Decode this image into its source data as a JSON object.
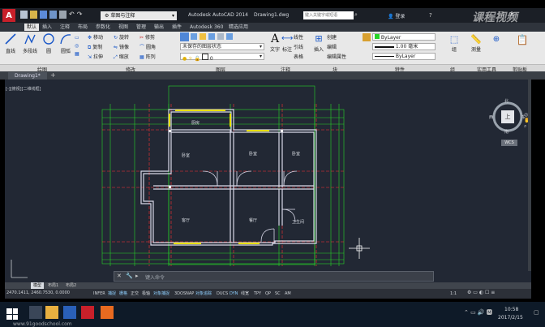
{
  "titlebar": {
    "workspace": "草图与注释",
    "app_title": "Autodesk AutoCAD 2014",
    "doc_title": "Drawing1.dwg",
    "search_placeholder": "键入关键字或短语",
    "login": "登录",
    "watermark": "课程视频"
  },
  "ribbon_tabs": [
    "默认",
    "插入",
    "注释",
    "布局",
    "参数化",
    "视图",
    "管理",
    "输出",
    "插件",
    "Autodesk 360",
    "精选应用"
  ],
  "ribbon": {
    "draw": [
      "直线",
      "多段线",
      "圆",
      "圆弧"
    ],
    "modify": [
      "移动",
      "旋转",
      "修剪",
      "复制",
      "镜像",
      "圆角",
      "拉伸",
      "缩放",
      "阵列"
    ],
    "layer_state": "未保存的图层状态",
    "layer_current": "0",
    "annotation": [
      "文字",
      "标注",
      "线性",
      "引线",
      "表格"
    ],
    "block": [
      "插入",
      "创建",
      "编辑",
      "编辑属性"
    ],
    "properties": [
      "ByLayer",
      "1.00 毫米",
      "ByLayer"
    ],
    "right": [
      "组",
      "测量",
      "基点",
      "剪贴板"
    ],
    "panel_labels": [
      "绘图",
      "修改",
      "图层",
      "注释",
      "块",
      "特性",
      "组",
      "实用工具",
      "剪贴板"
    ]
  },
  "doc_tab": "Drawing1*",
  "viewport_label": "[-][俯视][二维线框]",
  "viewcube": {
    "face": "上",
    "north": "北",
    "south": "南",
    "east": "东",
    "west": "西",
    "wcs": "WCS"
  },
  "rooms": [
    "厨房",
    "卧室",
    "卧室",
    "卧室",
    "客厅",
    "餐厅",
    "卫生间"
  ],
  "command": {
    "placeholder": "键入命令"
  },
  "layout_tabs": [
    "模型",
    "布局1",
    "布局2"
  ],
  "status": {
    "coords": "2470.1411, 2460.7530, 0.0000",
    "buttons": [
      "INFER",
      "捕捉",
      "栅格",
      "正交",
      "极轴",
      "对象捕捉",
      "3DOSNAP",
      "对象追踪",
      "DUCS",
      "DYN",
      "线宽",
      "TPY",
      "QP",
      "SC",
      "AM"
    ],
    "scale": "1:1"
  },
  "taskbar": {
    "time": "10:58",
    "date": "2017/2/15",
    "site": "www.91goodschool.com"
  },
  "colors": {
    "wall": "#d8d8e8",
    "dim": "#27d427",
    "axis": "#ff3333",
    "window": "#e8e000",
    "accent": "#c83a3a"
  }
}
